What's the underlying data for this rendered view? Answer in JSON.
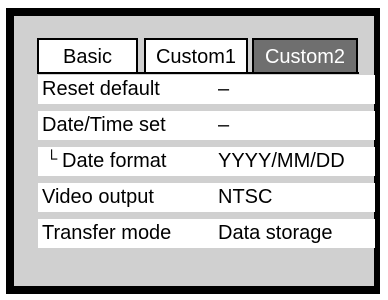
{
  "tabs": [
    {
      "label": "Basic",
      "active": false
    },
    {
      "label": "Custom1",
      "active": false
    },
    {
      "label": "Custom2",
      "active": true
    }
  ],
  "menu": [
    {
      "label": "Reset default",
      "value": "–"
    },
    {
      "label": "Date/Time set",
      "value": "–"
    },
    {
      "label": "Date format",
      "value": "YYYY/MM/DD",
      "indent_glyph": "└"
    },
    {
      "label": "Video output",
      "value": "NTSC"
    },
    {
      "label": "Transfer mode",
      "value": "Data storage"
    }
  ],
  "colors": {
    "frame": "#000000",
    "panel_background": "#d0d0d0",
    "row_background": "#ffffff",
    "active_tab_background": "#6f6f6f",
    "active_tab_text": "#ffffff"
  }
}
